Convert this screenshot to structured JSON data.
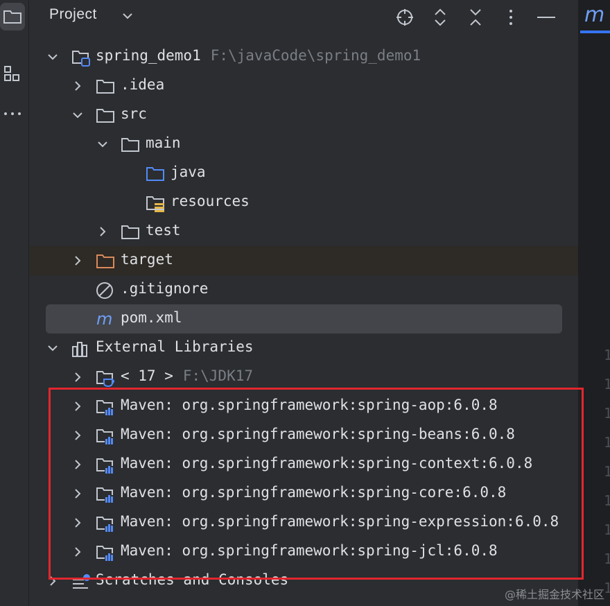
{
  "header": {
    "title": "Project",
    "editor_tab_glyph": "m"
  },
  "colors": {
    "background": "#2b2d30",
    "folder": "#c3c7cf",
    "java_folder": "#548af7",
    "pom": "#6e9ef5",
    "target_folder": "#d98a5c",
    "annotation": "#e2262e",
    "muted_text": "#7a7e85"
  },
  "tree": {
    "root": {
      "name": "spring_demo1",
      "path": "F:\\javaCode\\spring_demo1",
      "icon": "module-folder-icon"
    },
    "idea": {
      "name": ".idea",
      "icon": "folder-icon"
    },
    "src": {
      "name": "src",
      "icon": "folder-icon"
    },
    "main": {
      "name": "main",
      "icon": "folder-icon"
    },
    "java": {
      "name": "java",
      "icon": "source-folder-icon"
    },
    "resources": {
      "name": "resources",
      "icon": "resources-folder-icon"
    },
    "test": {
      "name": "test",
      "icon": "folder-icon"
    },
    "target": {
      "name": "target",
      "icon": "excluded-folder-icon"
    },
    "gitignore": {
      "name": ".gitignore",
      "icon": "ignored-file-icon"
    },
    "pom": {
      "name": "pom.xml",
      "icon": "maven-icon"
    },
    "external": {
      "name": "External Libraries",
      "icon": "libraries-icon"
    },
    "jdk": {
      "name": "< 17 >",
      "path": "F:\\JDK17",
      "icon": "jdk-icon"
    },
    "maven_libs": [
      {
        "name": "Maven: org.springframework:spring-aop:6.0.8"
      },
      {
        "name": "Maven: org.springframework:spring-beans:6.0.8"
      },
      {
        "name": "Maven: org.springframework:spring-context:6.0.8"
      },
      {
        "name": "Maven: org.springframework:spring-core:6.0.8"
      },
      {
        "name": "Maven: org.springframework:spring-expression:6.0.8"
      },
      {
        "name": "Maven: org.springframework:spring-jcl:6.0.8"
      }
    ],
    "scratches": {
      "name": "Scratches and Consoles",
      "icon": "scratches-icon"
    }
  },
  "editor": {
    "line_digits": [
      "1",
      "1",
      "1",
      "1",
      "1",
      "1",
      "1",
      "1",
      "1"
    ]
  },
  "watermark": "@稀土掘金技术社区"
}
